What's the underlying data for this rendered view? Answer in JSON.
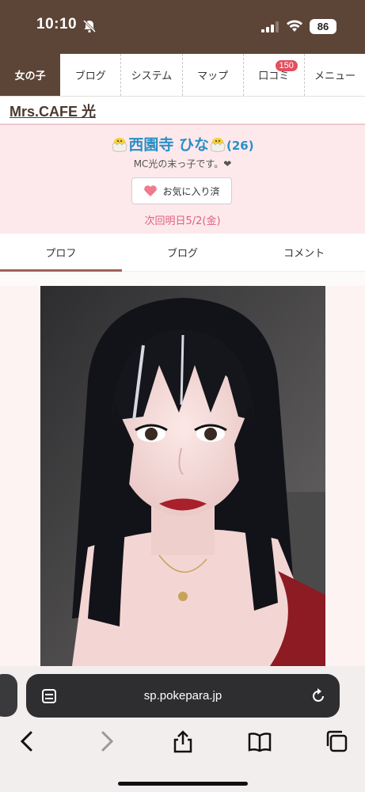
{
  "status": {
    "time": "10:10",
    "battery": "86"
  },
  "nav": {
    "items": [
      "女の子",
      "ブログ",
      "システム",
      "マップ",
      "口コミ",
      "メニュー"
    ],
    "review_badge": "150"
  },
  "shop": {
    "name": "Mrs.CAFE 光"
  },
  "profile": {
    "name": "西園寺 ひな",
    "age": "(26)",
    "catchphrase": "MC光の末っ子です。❤︎",
    "favorite_label": "お気に入り済",
    "next_schedule": "次回明日5/2(金)"
  },
  "tabs": [
    "プロフ",
    "ブログ",
    "コメント"
  ],
  "browser": {
    "url": "sp.pokepara.jp"
  },
  "colors": {
    "brand": "#5c4437",
    "pink_bg": "#fde9ec",
    "name_blue": "#2b8fc6",
    "accent_pink": "#e0607e"
  }
}
